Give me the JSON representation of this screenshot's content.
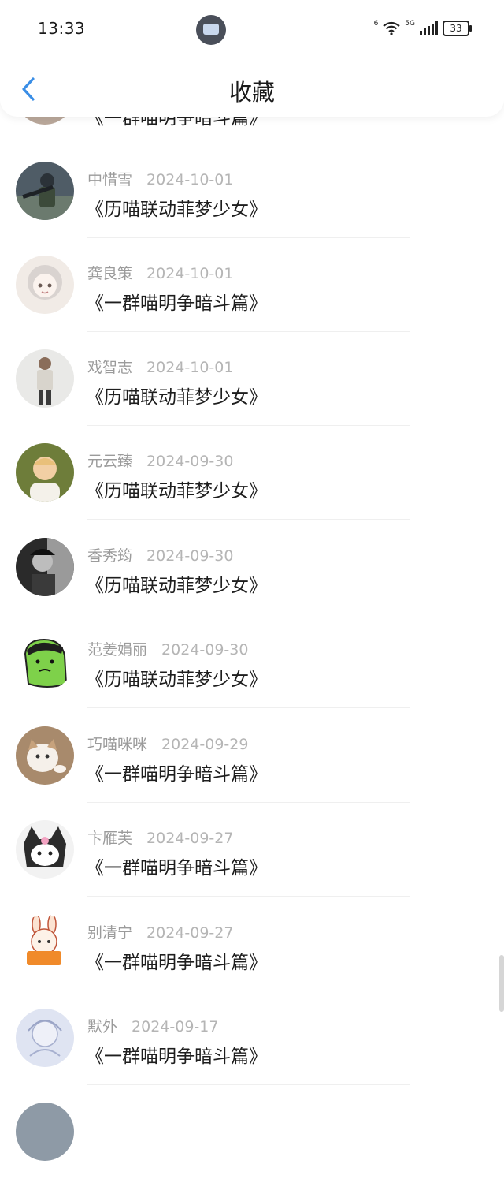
{
  "status_bar": {
    "time": "13:33",
    "wifi_label": "6",
    "network_label": "5G",
    "battery": "33"
  },
  "header": {
    "title": "收藏",
    "back_icon": "chevron-left-icon",
    "accent_color": "#3a8ee6"
  },
  "partial_top_item": {
    "title": "《一群喵明争暗斗篇》"
  },
  "items": [
    {
      "name": "中惜雪",
      "date": "2024-10-01",
      "title": "《历喵联动菲梦少女》",
      "avatar": "soldier-avatar"
    },
    {
      "name": "龚良策",
      "date": "2024-10-01",
      "title": "《一群喵明争暗斗篇》",
      "avatar": "anime-girl-avatar"
    },
    {
      "name": "戏智志",
      "date": "2024-10-01",
      "title": "《历喵联动菲梦少女》",
      "avatar": "game-character-avatar"
    },
    {
      "name": "元云臻",
      "date": "2024-09-30",
      "title": "《历喵联动菲梦少女》",
      "avatar": "child-avatar"
    },
    {
      "name": "香秀筠",
      "date": "2024-09-30",
      "title": "《历喵联动菲梦少女》",
      "avatar": "bw-portrait-avatar"
    },
    {
      "name": "范姜娟丽",
      "date": "2024-09-30",
      "title": "《历喵联动菲梦少女》",
      "avatar": "green-hulk-avatar"
    },
    {
      "name": "巧喵咪咪",
      "date": "2024-09-29",
      "title": "《一群喵明争暗斗篇》",
      "avatar": "cat-avatar"
    },
    {
      "name": "卞雁芙",
      "date": "2024-09-27",
      "title": "《一群喵明争暗斗篇》",
      "avatar": "kuromi-avatar"
    },
    {
      "name": "别清宁",
      "date": "2024-09-27",
      "title": "《一群喵明争暗斗篇》",
      "avatar": "bunny-cartoon-avatar"
    },
    {
      "name": "默外",
      "date": "2024-09-17",
      "title": "《一群喵明争暗斗篇》",
      "avatar": "sketch-avatar"
    }
  ]
}
